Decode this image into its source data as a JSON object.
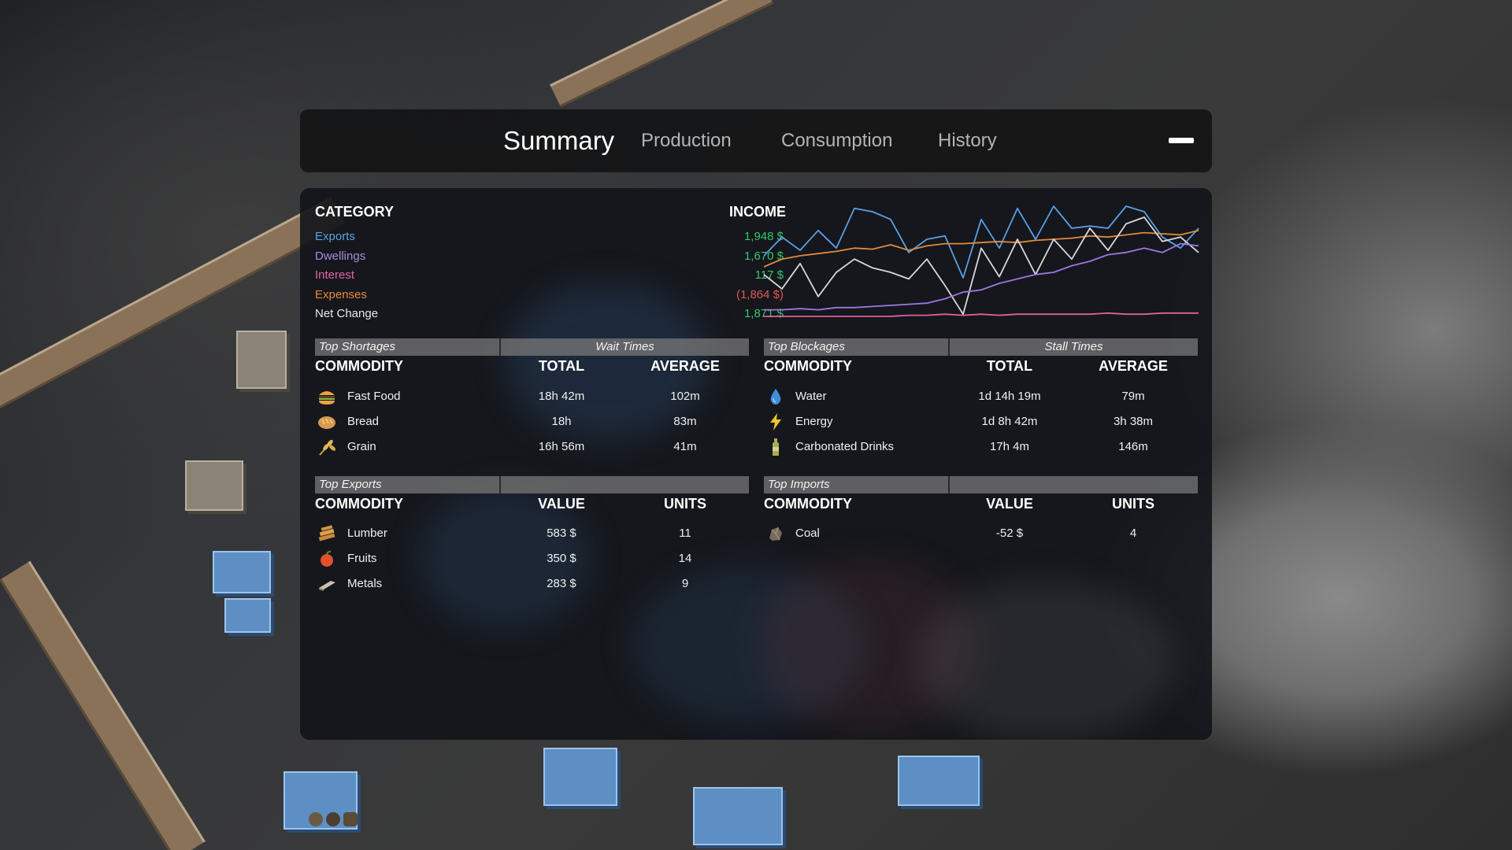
{
  "tabs": [
    {
      "label": "Summary",
      "active": true
    },
    {
      "label": "Production",
      "active": false
    },
    {
      "label": "Consumption",
      "active": false
    },
    {
      "label": "History",
      "active": false
    }
  ],
  "summary": {
    "category_header": "CATEGORY",
    "income_header": "INCOME",
    "rows": [
      {
        "label": "Exports",
        "value": "1,948 $",
        "label_color": "#5aa2e6",
        "value_color": "#37c76a"
      },
      {
        "label": "Dwellings",
        "value": "1,670 $",
        "label_color": "#a98ae0",
        "value_color": "#37c76a"
      },
      {
        "label": "Interest",
        "value": "117 $",
        "label_color": "#e264a6",
        "value_color": "#37c76a"
      },
      {
        "label": "Expenses",
        "value": "(1,864 $)",
        "label_color": "#e58a3a",
        "value_color": "#e25555"
      },
      {
        "label": "Net Change",
        "value": "1,871 $",
        "label_color": "#e8e8e8",
        "value_color": "#37c76a"
      }
    ]
  },
  "chart_data": {
    "type": "line",
    "title": "",
    "xlabel": "",
    "ylabel": "",
    "grid": false,
    "x": [
      0,
      1,
      2,
      3,
      4,
      5,
      6,
      7,
      8,
      9,
      10,
      11,
      12,
      13,
      14,
      15,
      16,
      17,
      18,
      19,
      20,
      21,
      22,
      23,
      24
    ],
    "series": [
      {
        "color": "#5b9ee6",
        "values": [
          0.55,
          0.72,
          0.6,
          0.78,
          0.62,
          0.98,
          0.95,
          0.88,
          0.58,
          0.7,
          0.73,
          0.35,
          0.88,
          0.62,
          0.98,
          0.7,
          1.0,
          0.8,
          0.82,
          0.8,
          1.0,
          0.95,
          0.72,
          0.62,
          0.8
        ]
      },
      {
        "color": "#e38a3e",
        "values": [
          0.45,
          0.52,
          0.55,
          0.57,
          0.59,
          0.62,
          0.61,
          0.65,
          0.6,
          0.64,
          0.66,
          0.66,
          0.67,
          0.68,
          0.67,
          0.69,
          0.7,
          0.71,
          0.73,
          0.72,
          0.74,
          0.76,
          0.75,
          0.74,
          0.78
        ]
      },
      {
        "color": "#d8d8d8",
        "values": [
          0.38,
          0.25,
          0.48,
          0.18,
          0.4,
          0.52,
          0.44,
          0.4,
          0.34,
          0.52,
          0.28,
          0.02,
          0.62,
          0.36,
          0.7,
          0.38,
          0.7,
          0.52,
          0.8,
          0.6,
          0.84,
          0.9,
          0.68,
          0.72,
          0.58
        ]
      },
      {
        "color": "#9a78e0",
        "values": [
          0.06,
          0.06,
          0.07,
          0.06,
          0.08,
          0.08,
          0.09,
          0.1,
          0.11,
          0.12,
          0.16,
          0.22,
          0.24,
          0.3,
          0.34,
          0.38,
          0.4,
          0.46,
          0.5,
          0.56,
          0.58,
          0.62,
          0.58,
          0.66,
          0.64
        ]
      },
      {
        "color": "#e0609e",
        "values": [
          0.0,
          0.0,
          0.0,
          0.0,
          0.0,
          0.0,
          0.0,
          0.0,
          0.01,
          0.01,
          0.02,
          0.01,
          0.02,
          0.01,
          0.02,
          0.02,
          0.02,
          0.02,
          0.02,
          0.03,
          0.02,
          0.02,
          0.03,
          0.03,
          0.03
        ]
      }
    ]
  },
  "shortages": {
    "section_title": "Top Shortages",
    "sub_title": "Wait Times",
    "col_commodity": "COMMODITY",
    "col_total": "TOTAL",
    "col_average": "AVERAGE",
    "rows": [
      {
        "icon": "burger-icon",
        "name": "Fast Food",
        "total": "18h 42m",
        "average": "102m"
      },
      {
        "icon": "bread-icon",
        "name": "Bread",
        "total": "18h",
        "average": "83m"
      },
      {
        "icon": "grain-icon",
        "name": "Grain",
        "total": "16h 56m",
        "average": "41m"
      }
    ]
  },
  "blockages": {
    "section_title": "Top Blockages",
    "sub_title": "Stall Times",
    "col_commodity": "COMMODITY",
    "col_total": "TOTAL",
    "col_average": "AVERAGE",
    "rows": [
      {
        "icon": "water-drop-icon",
        "name": "Water",
        "total": "1d 14h 19m",
        "average": "79m"
      },
      {
        "icon": "lightning-icon",
        "name": "Energy",
        "total": "1d 8h 42m",
        "average": "3h 38m"
      },
      {
        "icon": "bottle-icon",
        "name": "Carbonated Drinks",
        "total": "17h 4m",
        "average": "146m"
      }
    ]
  },
  "exports": {
    "section_title": "Top Exports",
    "col_commodity": "COMMODITY",
    "col_value": "VALUE",
    "col_units": "UNITS",
    "rows": [
      {
        "icon": "lumber-icon",
        "name": "Lumber",
        "value": "583 $",
        "units": "11"
      },
      {
        "icon": "fruit-icon",
        "name": "Fruits",
        "value": "350 $",
        "units": "14"
      },
      {
        "icon": "metal-ingot-icon",
        "name": "Metals",
        "value": "283 $",
        "units": "9"
      }
    ]
  },
  "imports": {
    "section_title": "Top Imports",
    "col_commodity": "COMMODITY",
    "col_value": "VALUE",
    "col_units": "UNITS",
    "rows": [
      {
        "icon": "coal-icon",
        "name": "Coal",
        "value": "-52 $",
        "units": "4"
      }
    ]
  }
}
